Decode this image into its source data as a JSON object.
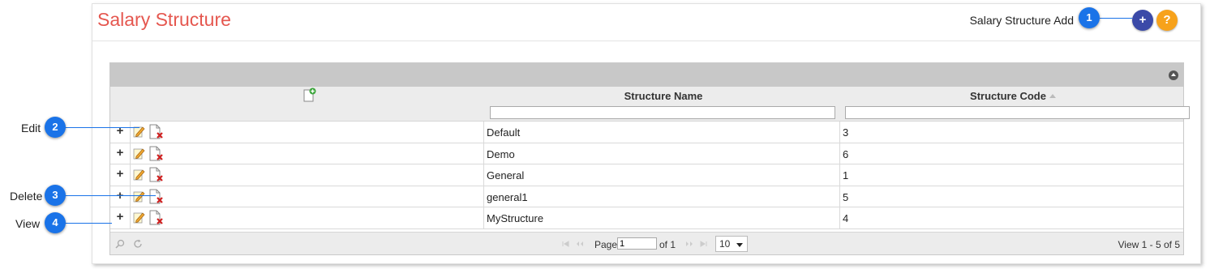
{
  "page": {
    "title": "Salary Structure",
    "add_label": "Salary Structure Add"
  },
  "buttons": {
    "add_symbol": "+",
    "help_symbol": "?"
  },
  "grid": {
    "columns": [
      {
        "label": "Structure Name"
      },
      {
        "label": "Structure Code"
      }
    ],
    "rows": [
      {
        "name": "Default",
        "code": "3"
      },
      {
        "name": "Demo",
        "code": "6"
      },
      {
        "name": "General",
        "code": "1"
      },
      {
        "name": "general1",
        "code": "5"
      },
      {
        "name": "MyStructure",
        "code": "4"
      }
    ],
    "expand_symbol": "+"
  },
  "pager": {
    "page_label": "Page",
    "page_value": "1",
    "of_label": "of 1",
    "rows_per_page": "10",
    "view_info": "View 1 - 5 of 5"
  },
  "callouts": [
    {
      "number": "1",
      "label": ""
    },
    {
      "number": "2",
      "label": "Edit"
    },
    {
      "number": "3",
      "label": "Delete"
    },
    {
      "number": "4",
      "label": "View"
    }
  ],
  "colors": {
    "title": "#e5574f",
    "add_button": "#3b4aa8",
    "help_button": "#f7a21b",
    "callout": "#1a73e8"
  },
  "icons": [
    "search-icon",
    "refresh-icon",
    "add-row-icon",
    "edit-icon",
    "delete-icon",
    "collapse-icon"
  ]
}
